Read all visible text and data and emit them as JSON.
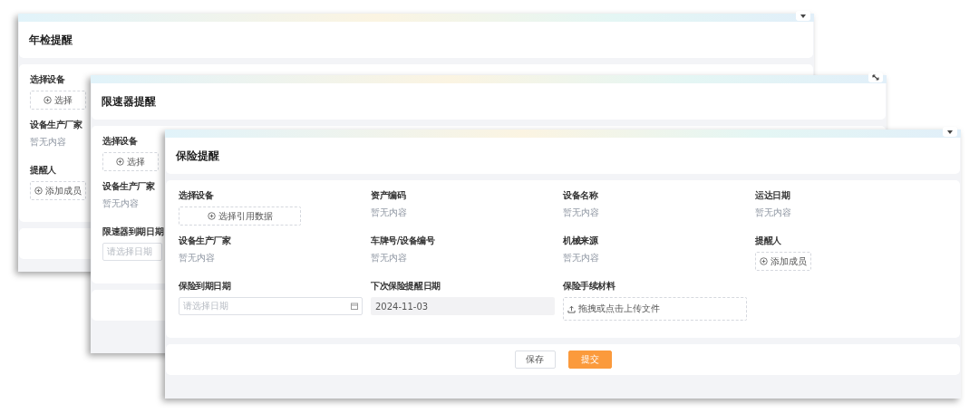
{
  "windows": [
    {
      "title": "年检提醒",
      "corner": {
        "kind": "caret"
      },
      "columns": [
        [
          {
            "kind": "select",
            "label": "选择设备",
            "button": "选择"
          },
          {
            "kind": "text",
            "label": "设备生产厂家",
            "value": "暂无内容"
          },
          {
            "kind": "member",
            "label": "提醒人",
            "button": "添加成员"
          }
        ]
      ]
    },
    {
      "title": "限速器提醒",
      "corner": {
        "kind": "expand"
      },
      "columns": [
        [
          {
            "kind": "select",
            "label": "选择设备",
            "button": "选择"
          },
          {
            "kind": "text",
            "label": "设备生产厂家",
            "value": "暂无内容"
          },
          {
            "kind": "date",
            "label": "限速器到期日期",
            "placeholder": "请选择日期"
          }
        ]
      ]
    },
    {
      "title": "保险提醒",
      "corner": {
        "kind": "caret"
      },
      "columns": [
        [
          {
            "kind": "select",
            "label": "选择设备",
            "button": "选择引用数据"
          },
          {
            "kind": "text",
            "label": "设备生产厂家",
            "value": "暂无内容"
          },
          {
            "kind": "date",
            "label": "保险到期日期",
            "placeholder": "请选择日期"
          }
        ],
        [
          {
            "kind": "text",
            "label": "资产编码",
            "value": "暂无内容"
          },
          {
            "kind": "text",
            "label": "车牌号/设备编号",
            "value": "暂无内容"
          },
          {
            "kind": "readonly",
            "label": "下次保险提醒日期",
            "value": "2024-11-03"
          }
        ],
        [
          {
            "kind": "text",
            "label": "设备名称",
            "value": "暂无内容"
          },
          {
            "kind": "text",
            "label": "机械来源",
            "value": "暂无内容"
          },
          {
            "kind": "upload",
            "label": "保险手续材料",
            "button": "拖拽或点击上传文件"
          }
        ],
        [
          {
            "kind": "text",
            "label": "运达日期",
            "value": "暂无内容"
          },
          {
            "kind": "member",
            "label": "提醒人",
            "button": "添加成员"
          }
        ]
      ],
      "buttons": [
        {
          "kind": "default",
          "label": "保存"
        },
        {
          "kind": "primary",
          "label": "提交"
        }
      ]
    }
  ]
}
